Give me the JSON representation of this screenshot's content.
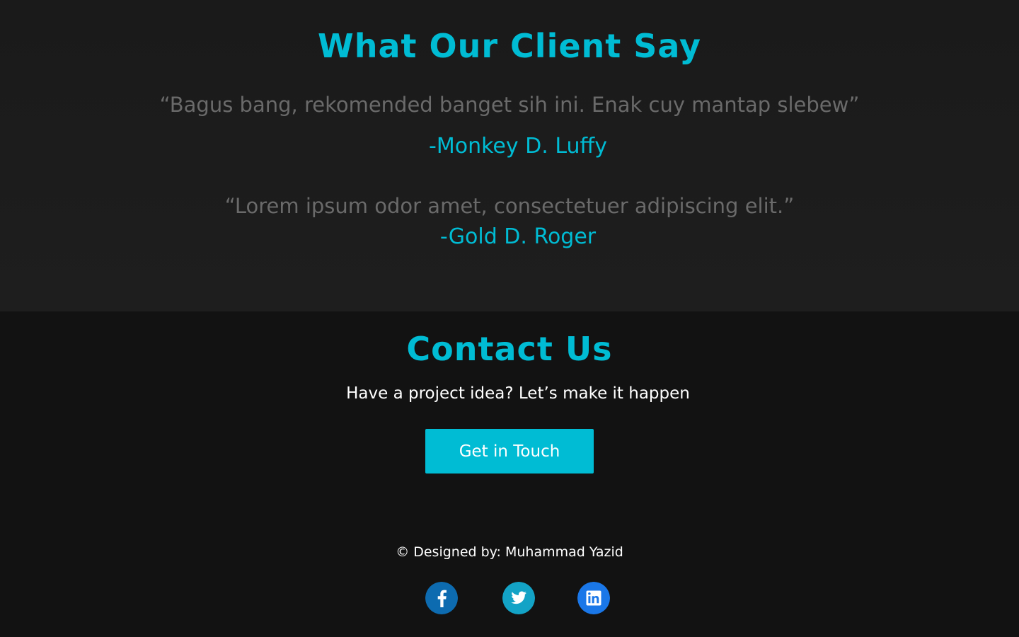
{
  "testimonials": {
    "title": "What Our Client Say",
    "items": [
      {
        "quote": "“Bagus bang, rekomended banget sih ini. Enak cuy mantap slebew”",
        "author": "-Monkey D. Luffy"
      },
      {
        "quote": "“Lorem ipsum odor amet, consectetuer adipiscing elit.”",
        "author": "-Gold D. Roger"
      }
    ]
  },
  "contact": {
    "title": "Contact Us",
    "subtitle": "Have a project idea? Let’s make it happen",
    "cta_label": "Get in Touch"
  },
  "footer": {
    "copyright": "© Designed by: Muhammad Yazid",
    "social": [
      {
        "icon": "facebook-icon",
        "color": "#0d6bb0"
      },
      {
        "icon": "twitter-icon",
        "color": "#13a3c6"
      },
      {
        "icon": "linkedin-icon",
        "color": "#1a77e8"
      }
    ]
  },
  "colors": {
    "accent": "#00bcd4",
    "testimonial_bg": "#1c1c1c",
    "contact_bg": "#121212",
    "quote_text": "#6a6a6a",
    "body_text": "#ffffff"
  }
}
